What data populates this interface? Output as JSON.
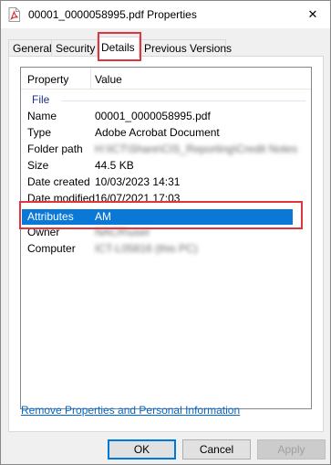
{
  "window": {
    "title": "00001_0000058995.pdf Properties",
    "icon": "pdf-file-icon",
    "close_label": "✕"
  },
  "tabs": [
    {
      "label": "General",
      "active": false
    },
    {
      "label": "Security",
      "active": false
    },
    {
      "label": "Details",
      "active": true
    },
    {
      "label": "Previous Versions",
      "active": false
    }
  ],
  "details": {
    "header": {
      "property": "Property",
      "value": "Value"
    },
    "group": "File",
    "rows": [
      {
        "property": "Name",
        "value": "00001_0000058995.pdf"
      },
      {
        "property": "Type",
        "value": "Adobe Acrobat Document"
      },
      {
        "property": "Folder path",
        "value": "H:\\ICT\\Share\\CIS_Reporting\\Credit Notes"
      },
      {
        "property": "Size",
        "value": "44.5 KB"
      },
      {
        "property": "Date created",
        "value": "10/03/2023 14:31"
      },
      {
        "property": "Date modified",
        "value": "16/07/2021 17:03"
      },
      {
        "property": "Attributes",
        "value": "AM"
      },
      {
        "property": "Owner",
        "value": "NACR\\user"
      },
      {
        "property": "Computer",
        "value": "ICT-L05816 (this PC)"
      }
    ],
    "selected_row": "Attributes"
  },
  "remove_link": "Remove Properties and Personal Information",
  "buttons": {
    "ok": "OK",
    "cancel": "Cancel",
    "apply": "Apply"
  },
  "colors": {
    "selection": "#0a78d7",
    "highlight": "#e0353a",
    "link": "#0066cc"
  }
}
